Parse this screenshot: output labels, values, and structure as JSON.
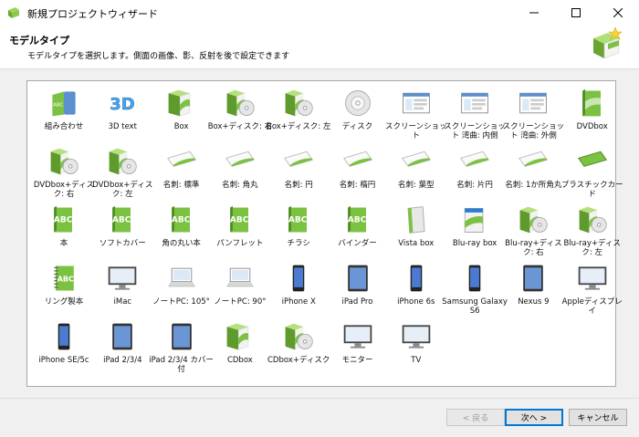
{
  "window": {
    "title": "新規プロジェクトウィザード"
  },
  "header": {
    "title": "モデルタイプ",
    "subtitle": "モデルタイプを選択します。側面の画像、影、反射を後で設定できます"
  },
  "models": [
    {
      "label": "組み合わせ",
      "icon": "combo-icon"
    },
    {
      "label": "3D text",
      "icon": "3d-text-icon"
    },
    {
      "label": "Box",
      "icon": "box-icon"
    },
    {
      "label": "Box+ディスク: 右",
      "icon": "box-disc-right-icon"
    },
    {
      "label": "Box+ディスク: 左",
      "icon": "box-disc-left-icon"
    },
    {
      "label": "ディスク",
      "icon": "disc-icon"
    },
    {
      "label": "スクリーンショット",
      "icon": "screenshot-icon"
    },
    {
      "label": "スクリーンショット 湾曲: 内側",
      "icon": "screenshot-curved-in-icon"
    },
    {
      "label": "スクリーンショット 湾曲: 外側",
      "icon": "screenshot-curved-out-icon"
    },
    {
      "label": "DVDbox",
      "icon": "dvdbox-icon"
    },
    {
      "label": "DVDbox+ディスク: 右",
      "icon": "dvdbox-disc-right-icon"
    },
    {
      "label": "DVDbox+ディスク: 左",
      "icon": "dvdbox-disc-left-icon"
    },
    {
      "label": "名刺: 標準",
      "icon": "card-standard-icon"
    },
    {
      "label": "名刺: 角丸",
      "icon": "card-rounded-icon"
    },
    {
      "label": "名刺: 円",
      "icon": "card-circle-icon"
    },
    {
      "label": "名刺: 楕円",
      "icon": "card-ellipse-icon"
    },
    {
      "label": "名刺: 葉型",
      "icon": "card-leaf-icon"
    },
    {
      "label": "名刺: 片円",
      "icon": "card-half-circle-icon"
    },
    {
      "label": "名刺: 1か所角丸",
      "icon": "card-one-corner-icon"
    },
    {
      "label": "プラスチックカード",
      "icon": "plastic-card-icon"
    },
    {
      "label": "本",
      "icon": "book-icon"
    },
    {
      "label": "ソフトカバー",
      "icon": "softcover-icon"
    },
    {
      "label": "角の丸い本",
      "icon": "rounded-book-icon"
    },
    {
      "label": "パンフレット",
      "icon": "pamphlet-icon"
    },
    {
      "label": "チラシ",
      "icon": "flyer-icon"
    },
    {
      "label": "バインダー",
      "icon": "binder-icon"
    },
    {
      "label": "Vista box",
      "icon": "vista-box-icon"
    },
    {
      "label": "Blu-ray box",
      "icon": "bluray-box-icon"
    },
    {
      "label": "Blu-ray+ディスク: 右",
      "icon": "bluray-disc-right-icon"
    },
    {
      "label": "Blu-ray+ディスク: 左",
      "icon": "bluray-disc-left-icon"
    },
    {
      "label": "リング製本",
      "icon": "ring-binding-icon"
    },
    {
      "label": "iMac",
      "icon": "imac-icon"
    },
    {
      "label": "ノートPC: 105°",
      "icon": "laptop-105-icon"
    },
    {
      "label": "ノートPC: 90°",
      "icon": "laptop-90-icon"
    },
    {
      "label": "iPhone X",
      "icon": "iphone-x-icon"
    },
    {
      "label": "iPad Pro",
      "icon": "ipad-pro-icon"
    },
    {
      "label": "iPhone 6s",
      "icon": "iphone-6s-icon"
    },
    {
      "label": "Samsung Galaxy S6",
      "icon": "galaxy-s6-icon"
    },
    {
      "label": "Nexus 9",
      "icon": "nexus-9-icon"
    },
    {
      "label": "Appleディスプレイ",
      "icon": "apple-display-icon"
    },
    {
      "label": "iPhone SE/5c",
      "icon": "iphone-se-icon"
    },
    {
      "label": "iPad 2/3/4",
      "icon": "ipad-234-icon"
    },
    {
      "label": "iPad 2/3/4 カバー付",
      "icon": "ipad-cover-icon"
    },
    {
      "label": "CDbox",
      "icon": "cdbox-icon"
    },
    {
      "label": "CDbox+ディスク",
      "icon": "cdbox-disc-icon"
    },
    {
      "label": "モニター",
      "icon": "monitor-icon"
    },
    {
      "label": "TV",
      "icon": "tv-icon"
    }
  ],
  "footer": {
    "back_label": "< 戻る",
    "next_label": "次へ >",
    "cancel_label": "キャンセル"
  },
  "colors": {
    "accent_green": "#7cc242",
    "focus_blue": "#0078d7"
  }
}
